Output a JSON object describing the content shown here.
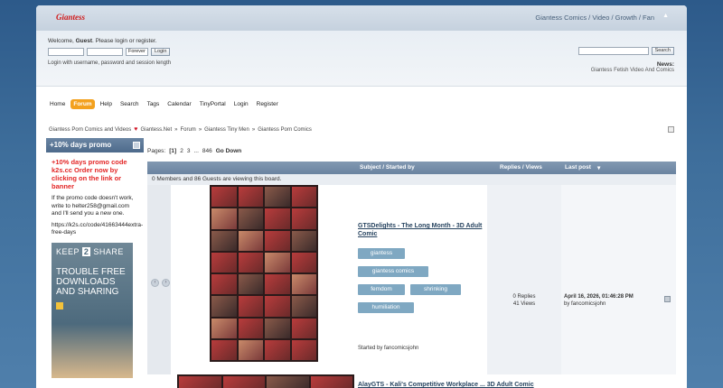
{
  "header": {
    "logo": "Giantess",
    "slogan": "Giantess Comics / Video / Growth / Fan"
  },
  "user": {
    "welcome_prefix": "Welcome, ",
    "guest": "Guest",
    "welcome_suffix": ". Please login or register.",
    "remember_option": "Forever",
    "login_button": "Login",
    "login_note": "Login with username, password and session length"
  },
  "search": {
    "button": "Search"
  },
  "news": {
    "label": "News:",
    "text": "Giantess Fetish Video And Comics"
  },
  "menu": [
    {
      "label": "Home",
      "active": false
    },
    {
      "label": "Forum",
      "active": true
    },
    {
      "label": "Help",
      "active": false
    },
    {
      "label": "Search",
      "active": false
    },
    {
      "label": "Tags",
      "active": false
    },
    {
      "label": "Calendar",
      "active": false
    },
    {
      "label": "TinyPortal",
      "active": false
    },
    {
      "label": "Login",
      "active": false
    },
    {
      "label": "Register",
      "active": false
    }
  ],
  "breadcrumb": {
    "site": "Giantess Porn Comics and Videos",
    "host": "Giantess.Net",
    "items": [
      "Forum",
      "Giantess Tiny Men",
      "Giantess Porn Comics"
    ],
    "sep": "»"
  },
  "sidebar": {
    "title": "+10% days promo",
    "promo": "+10% days promo code k2s.cc Order now by clicking on the link or banner",
    "note": "If the promo code doesn't work, write to helter258@gmail.com and I'll send you a new one.",
    "link": "https://k2s.cc/code/41663444extra-free-days",
    "banner_logo_a": "KEEP",
    "banner_logo_b": "2",
    "banner_logo_c": "SHARE",
    "banner_tagline": "TROUBLE FREE DOWNLOADS AND SHARING"
  },
  "pagination": {
    "label": "Pages:",
    "current": "[1]",
    "p2": "2",
    "p3": "3",
    "ellipsis": "...",
    "last": "846",
    "go_down": "Go Down"
  },
  "table": {
    "col_subject": "Subject / Started by",
    "col_replies": "Replies / Views",
    "col_last": "Last post",
    "viewing": "0 Members and 86 Guests are viewing this board."
  },
  "topics": [
    {
      "title": "GTSDelights - The Long Month - 3D Adult Comic",
      "tags": [
        "giantess",
        "giantess comics",
        "femdom",
        "shrinking",
        "humiliation"
      ],
      "started_by": "Started by fancomicsjohn",
      "replies": "0 Replies",
      "views": "41 Views",
      "last_date": "April 16, 2026, 01:46:28 PM",
      "last_by": "by fancomicsjohn"
    },
    {
      "title": "AlayGTS - Kali's Competitive Workplace ... 3D Adult Comic"
    }
  ]
}
